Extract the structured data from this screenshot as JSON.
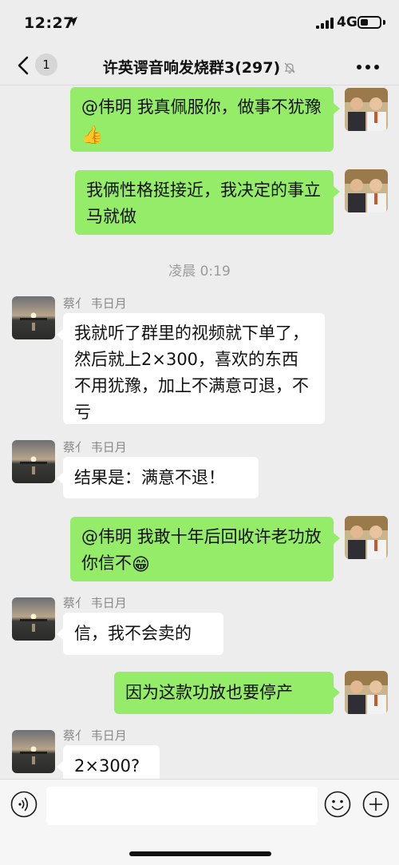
{
  "status_bar": {
    "time": "12:27",
    "network": "4G",
    "location_icon": "location-arrow-icon",
    "signal_icon": "signal-bars-icon",
    "battery_icon": "battery-icon",
    "battery_level": 0.3
  },
  "nav": {
    "back_icon": "chevron-left-icon",
    "unread_count": "1",
    "title": "许英谔音响发烧群",
    "member_count": "3(297)",
    "mute_icon": "bell-off-icon",
    "more_icon": "ellipsis-icon"
  },
  "messages": [
    {
      "side": "right",
      "text": "@伟明 我真佩服你，做事不犹豫",
      "emoji": "👍"
    },
    {
      "side": "right",
      "text": "我俩性格挺接近，我决定的事立马就做"
    },
    {
      "type": "timestamp",
      "text": "凌晨 0:19"
    },
    {
      "side": "left",
      "sender": "蔡亻 韦日月",
      "text": "我就听了群里的视频就下单了，然后就上2×300，喜欢的东西不用犹豫，加上不满意可退，不亏"
    },
    {
      "side": "left",
      "sender": "蔡亻 韦日月",
      "text": "结果是：满意不退！"
    },
    {
      "side": "right",
      "text": "@伟明 我敢十年后回收许老功放你信不",
      "emoji": "😁"
    },
    {
      "side": "left",
      "sender": "蔡亻 韦日月",
      "text": "信，我不会卖的"
    },
    {
      "side": "right",
      "text": "因为这款功放也要停产"
    },
    {
      "side": "left",
      "sender": "蔡亻 韦日月",
      "text": "2×300?"
    }
  ],
  "input_bar": {
    "voice_icon": "voice-icon",
    "emoji_icon": "smiley-icon",
    "plus_icon": "plus-circle-icon",
    "placeholder": ""
  }
}
